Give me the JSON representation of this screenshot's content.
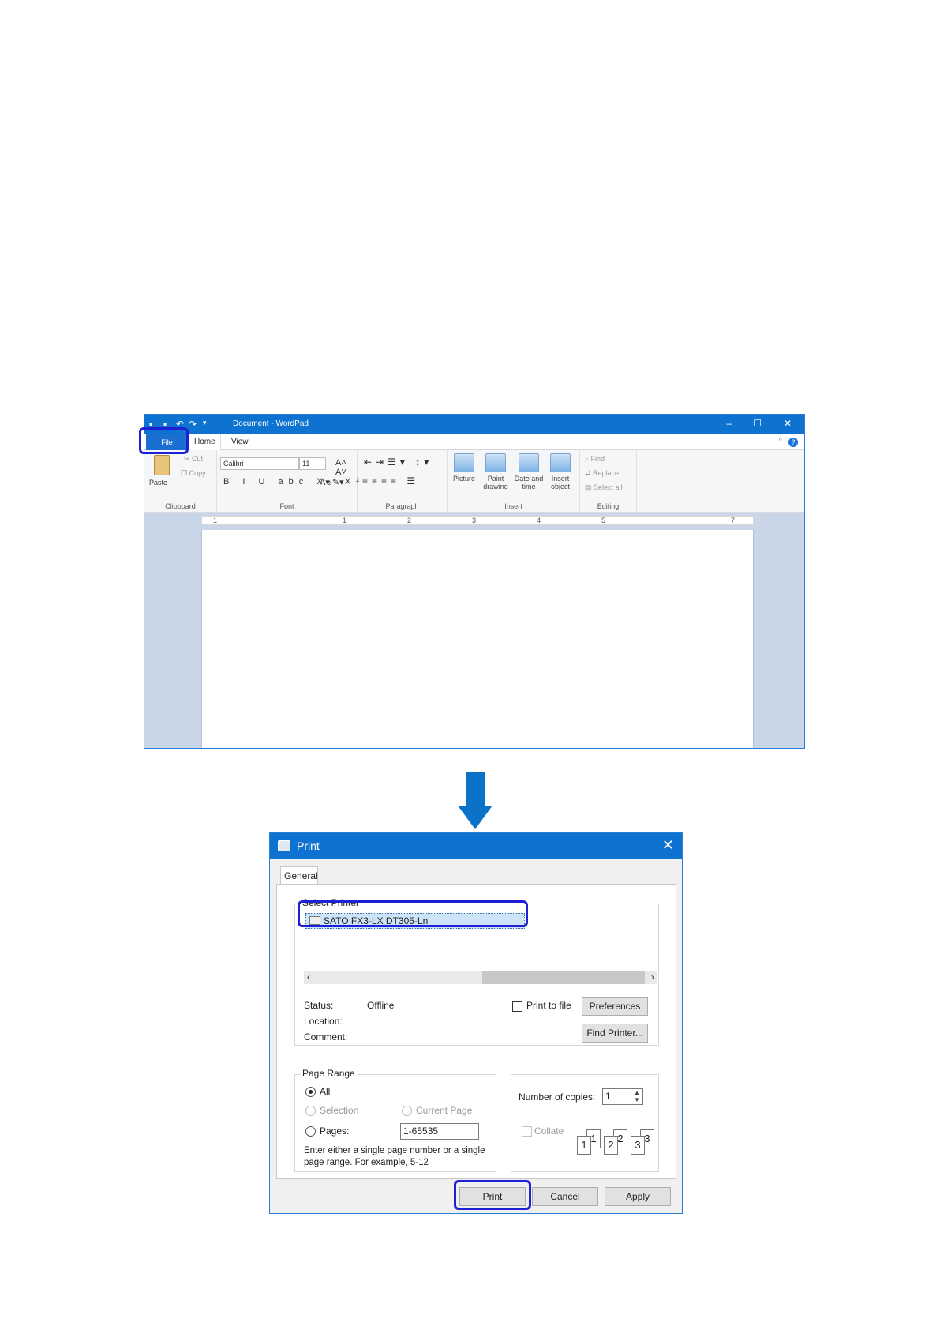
{
  "wordpad": {
    "title": "Document - WordPad",
    "tabs": {
      "file": "File",
      "home": "Home",
      "view": "View"
    },
    "clipboard": {
      "paste": "Paste",
      "cut": "Cut",
      "copy": "Copy",
      "group": "Clipboard"
    },
    "font": {
      "family": "Calibri",
      "size": "11",
      "group": "Font",
      "buttons": "B I U abc X₂ X²"
    },
    "paragraph": {
      "group": "Paragraph"
    },
    "insert": {
      "group": "Insert",
      "items": [
        "Picture",
        "Paint drawing",
        "Date and time",
        "Insert object"
      ]
    },
    "editing": {
      "group": "Editing",
      "find": "Find",
      "replace": "Replace",
      "select_all": "Select all"
    },
    "ruler": [
      "1",
      "1",
      "2",
      "3",
      "4",
      "5",
      "7"
    ]
  },
  "print_dialog": {
    "title": "Print",
    "tab": "General",
    "select_printer_label": "Select Printer",
    "printer_name": "SATO FX3-LX DT305-Ln",
    "status_label": "Status:",
    "status_value": "Offline",
    "location_label": "Location:",
    "comment_label": "Comment:",
    "print_to_file": "Print to file",
    "preferences": "Preferences",
    "find_printer": "Find Printer...",
    "page_range_label": "Page Range",
    "all": "All",
    "selection": "Selection",
    "current_page": "Current Page",
    "pages": "Pages:",
    "pages_value": "1-65535",
    "hint": "Enter either a single page number or a single page range.  For example, 5-12",
    "copies_label": "Number of copies:",
    "copies_value": "1",
    "collate": "Collate",
    "print_button": "Print",
    "cancel_button": "Cancel",
    "apply_button": "Apply"
  },
  "colors": {
    "accent": "#0e72d1",
    "highlight": "#1f1fd6",
    "arrow": "#0a73c7"
  }
}
